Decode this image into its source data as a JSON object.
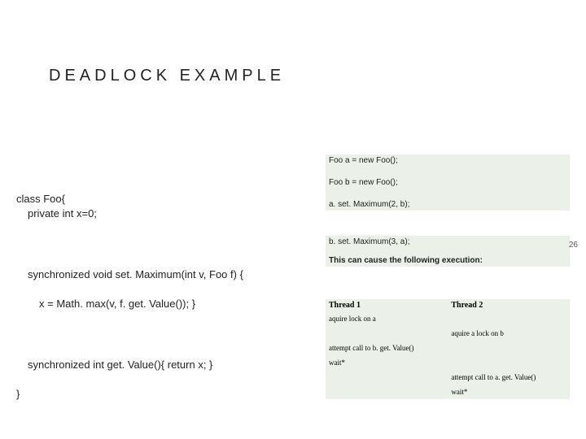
{
  "title": "DEADLOCK EXAMPLE",
  "page_number": "26",
  "code_left": {
    "l1": "class Foo{",
    "l2": "private int x=0;",
    "l3": "synchronized void set. Maximum(int v, Foo f) {",
    "l4": "x = Math. max(v, f. get. Value()); }",
    "l5": "synchronized int get. Value(){ return x; }",
    "l6": "}"
  },
  "exec_box": {
    "r1": "Foo a = new Foo();",
    "r2": "Foo b = new Foo();",
    "r3": "a. set. Maximum(2, b);",
    "r4": "b. set. Maximum(3, a);",
    "r5": "This can cause the following execution:"
  },
  "table": {
    "h1": "Thread 1",
    "h2": "Thread 2",
    "r1c1": "aquire lock on a",
    "r1c2": "",
    "r2c1": "",
    "r2c2": "aquire a lock on b",
    "r3c1": "attempt call to b. get. Value()",
    "r3c2": "",
    "r4c1": "wait*",
    "r4c2": "",
    "r5c1": "",
    "r5c2": "attempt call to a. get. Value()",
    "r6c1": "",
    "r6c2": "wait*"
  }
}
